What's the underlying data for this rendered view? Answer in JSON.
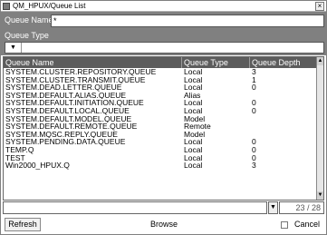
{
  "window": {
    "title": "QM_HPUX/Queue List"
  },
  "filters": {
    "queue_name_label": "Queue Name",
    "queue_name_value": "*",
    "queue_type_label": "Queue Type",
    "queue_type_value": ""
  },
  "table": {
    "columns": [
      "Queue Name",
      "Queue Type",
      "Queue Depth"
    ],
    "rows": [
      [
        "SYSTEM.CLUSTER.REPOSITORY.QUEUE",
        "Local",
        "3"
      ],
      [
        "SYSTEM.CLUSTER.TRANSMIT.QUEUE",
        "Local",
        "1"
      ],
      [
        "SYSTEM.DEAD.LETTER.QUEUE",
        "Local",
        "0"
      ],
      [
        "SYSTEM.DEFAULT.ALIAS.QUEUE",
        "Alias",
        ""
      ],
      [
        "SYSTEM.DEFAULT.INITIATION.QUEUE",
        "Local",
        "0"
      ],
      [
        "SYSTEM.DEFAULT.LOCAL.QUEUE",
        "Local",
        "0"
      ],
      [
        "SYSTEM.DEFAULT.MODEL.QUEUE",
        "Model",
        ""
      ],
      [
        "SYSTEM.DEFAULT.REMOTE.QUEUE",
        "Remote",
        ""
      ],
      [
        "SYSTEM.MQSC.REPLY.QUEUE",
        "Model",
        ""
      ],
      [
        "SYSTEM.PENDING.DATA.QUEUE",
        "Local",
        "0"
      ],
      [
        "TEMP.Q",
        "Local",
        "0"
      ],
      [
        "TEST",
        "Local",
        "0"
      ],
      [
        "Win2000_HPUX.Q",
        "Local",
        "3"
      ]
    ]
  },
  "status": {
    "text": "",
    "count": "23 / 28"
  },
  "buttons": {
    "refresh": "Refresh",
    "browse": "Browse",
    "cancel": "Cancel"
  }
}
